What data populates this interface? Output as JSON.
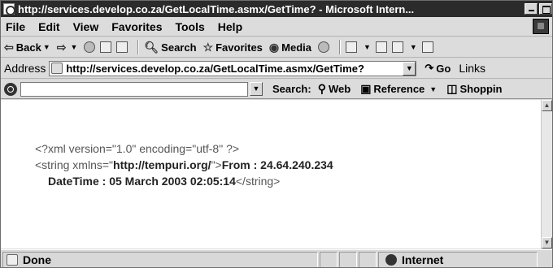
{
  "window": {
    "title": "http://services.develop.co.za/GetLocalTime.asmx/GetTime? - Microsoft Intern..."
  },
  "menu": [
    "File",
    "Edit",
    "View",
    "Favorites",
    "Tools",
    "Help"
  ],
  "toolbar": {
    "back_label": "Back",
    "search_label": "Search",
    "favorites_label": "Favorites",
    "media_label": "Media"
  },
  "address": {
    "label": "Address",
    "value": "http://services.develop.co.za/GetLocalTime.asmx/GetTime?",
    "go_label": "Go",
    "links_label": "Links"
  },
  "searchbar": {
    "label": "Search:",
    "web_label": "Web",
    "reference_label": "Reference",
    "shopping_label": "Shoppin"
  },
  "content": {
    "xml_decl": "<?xml version=\"1.0\" encoding=\"utf-8\" ?>",
    "string_open_prefix": "<string xmlns=\"",
    "namespace": "http://tempuri.org/",
    "string_open_suffix": "\">",
    "from_text": "From : 24.64.240.234",
    "datetime_text": "DateTime : 05 March 2003 02:05:14",
    "string_close": "</string>"
  },
  "status": {
    "text": "Done",
    "zone": "Internet"
  }
}
